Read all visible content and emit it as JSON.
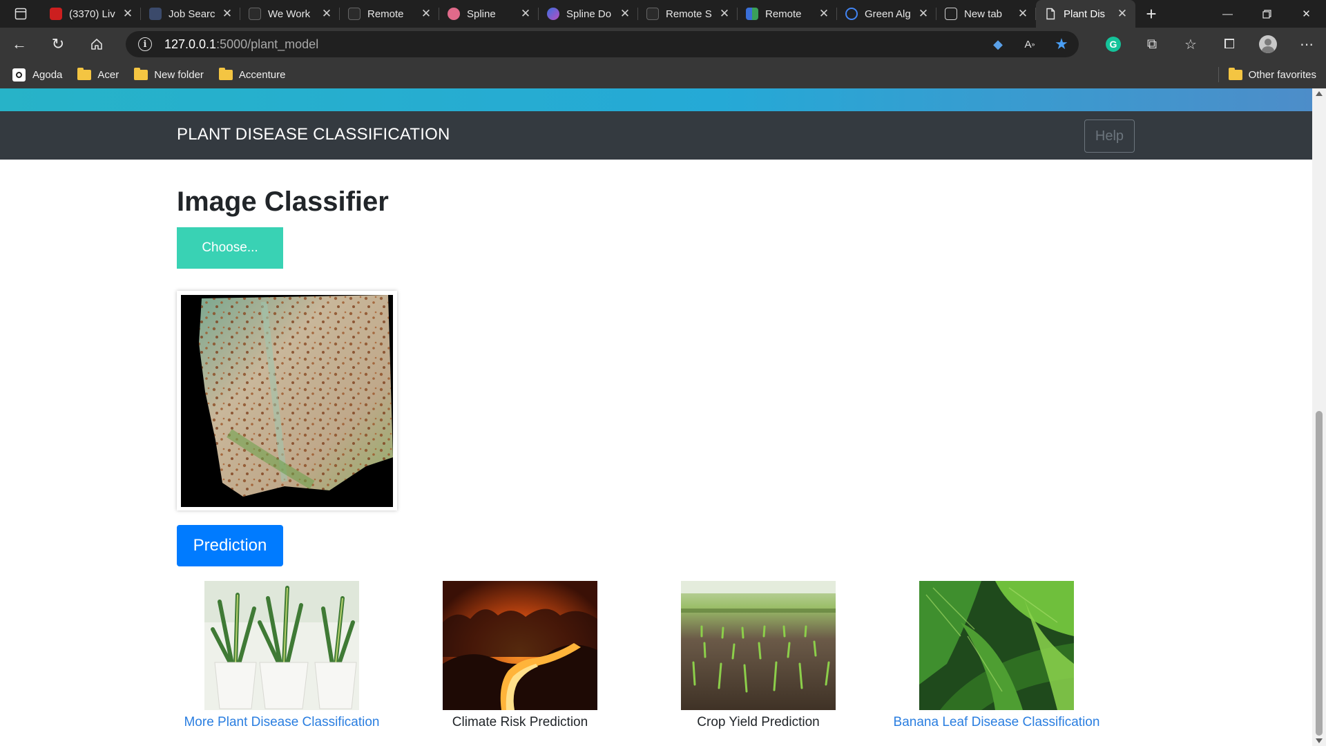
{
  "browser": {
    "tabs": [
      {
        "title": "(3370) Liv",
        "favicon": "youtube-icon",
        "color": "#cc1f1f"
      },
      {
        "title": "Job Searc",
        "favicon": "job-search-icon",
        "color": "#3b4a6b"
      },
      {
        "title": "We Work",
        "favicon": "weworkremotely-icon",
        "color": "#2b2b2b"
      },
      {
        "title": "Remote",
        "favicon": "weworkremotely-icon",
        "color": "#2b2b2b"
      },
      {
        "title": "Spline",
        "favicon": "spline-icon",
        "color": "#e06a8a"
      },
      {
        "title": "Spline Do",
        "favicon": "spline-doc-icon",
        "color": "#7a4fd0"
      },
      {
        "title": "Remote S",
        "favicon": "weworkremotely-icon",
        "color": "#2b2b2b"
      },
      {
        "title": "Remote",
        "favicon": "remote-icon",
        "color": "#3aa05a"
      },
      {
        "title": "Green Alg",
        "favicon": "google-icon",
        "color": "#4285f4"
      },
      {
        "title": "New tab",
        "favicon": "new-tab-icon",
        "color": "#333333"
      },
      {
        "title": "Plant Dis",
        "favicon": "page-icon",
        "color": "#373737"
      }
    ],
    "url_host": "127.0.0.1",
    "url_path": ":5000/plant_model",
    "bookmarks": [
      "Agoda",
      "Acer",
      "New folder",
      "Accenture"
    ],
    "other_favorites": "Other favorites"
  },
  "page": {
    "brand": "PLANT DISEASE CLASSIFICATION",
    "help_label": "Help",
    "heading": "Image Classifier",
    "choose_label": "Choose...",
    "predict_label": "Prediction",
    "cards": [
      {
        "caption": "More Plant Disease Classification",
        "link": true
      },
      {
        "caption": "Climate Risk Prediction",
        "link": false
      },
      {
        "caption": "Crop Yield Prediction",
        "link": false
      },
      {
        "caption": "Banana Leaf Disease Classification",
        "link": true
      }
    ]
  },
  "colors": {
    "navbar": "#343a40",
    "choose_button": "#39d2b4",
    "predict_button": "#007bff",
    "link": "#2a7ee0"
  }
}
